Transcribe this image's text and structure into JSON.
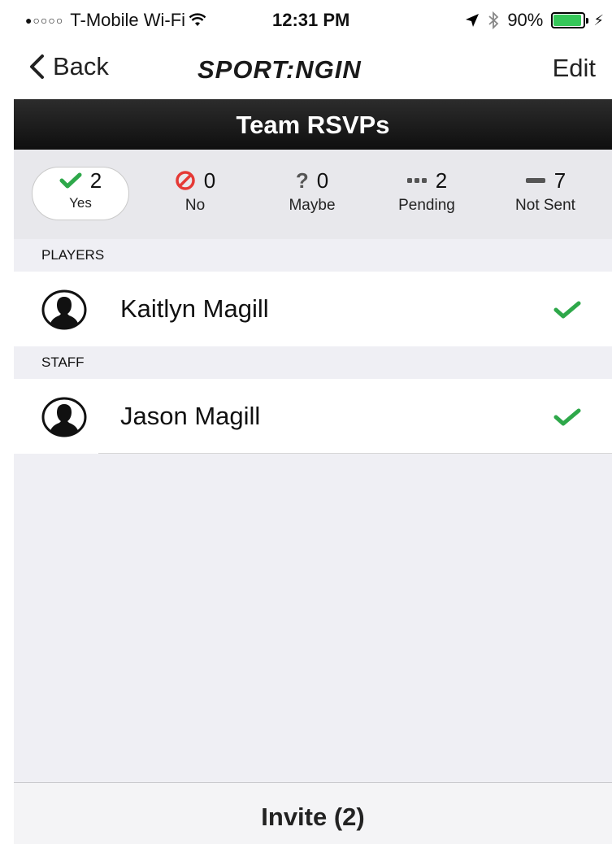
{
  "status_bar": {
    "carrier": "T-Mobile Wi-Fi",
    "time": "12:31 PM",
    "battery": "90%"
  },
  "nav": {
    "back_label": "Back",
    "logo_text": "SPORT:NGIN",
    "edit_label": "Edit"
  },
  "header": {
    "title": "Team RSVPs"
  },
  "rsvp_summary": [
    {
      "count": "2",
      "label": "Yes",
      "icon": "check-icon",
      "color": "#2ea84a",
      "selected": true
    },
    {
      "count": "0",
      "label": "No",
      "icon": "prohibited-icon",
      "color": "#e53935",
      "selected": false
    },
    {
      "count": "0",
      "label": "Maybe",
      "icon": "question-icon",
      "color": "#555555",
      "selected": false
    },
    {
      "count": "2",
      "label": "Pending",
      "icon": "ellipsis-icon",
      "color": "#555555",
      "selected": false
    },
    {
      "count": "7",
      "label": "Not Sent",
      "icon": "dash-icon",
      "color": "#555555",
      "selected": false
    }
  ],
  "sections": [
    {
      "title": "PLAYERS",
      "members": [
        {
          "name": "Kaitlyn Magill",
          "status_icon": "check-icon"
        }
      ]
    },
    {
      "title": "STAFF",
      "members": [
        {
          "name": "Jason Magill",
          "status_icon": "check-icon"
        }
      ]
    }
  ],
  "toolbar": {
    "invite_label": "Invite (2)"
  },
  "colors": {
    "accent_green": "#2ea84a",
    "header_dark": "#1a1a1a",
    "background": "#efeff4"
  }
}
